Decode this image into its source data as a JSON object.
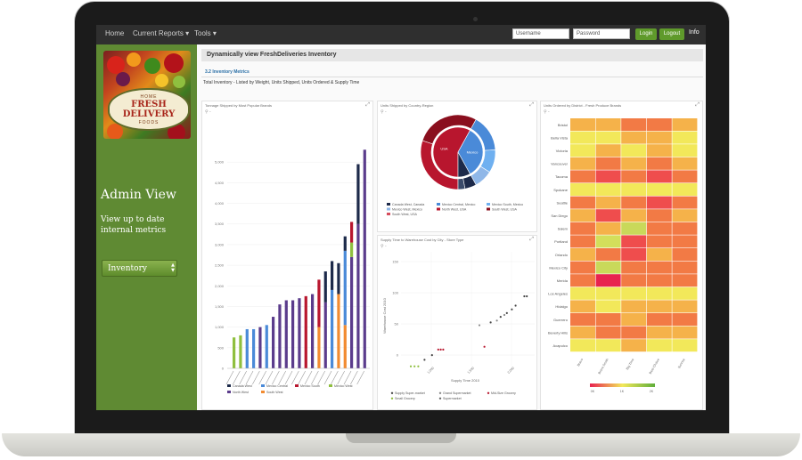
{
  "nav": {
    "home": "Home",
    "reports": "Current Reports",
    "tools": "Tools",
    "username_placeholder": "Username",
    "password_placeholder": "Password",
    "login": "Login",
    "logout": "Logout",
    "info": "Info"
  },
  "sidebar": {
    "logo_top": "HOME",
    "logo_main": "FRESH DELIVERY",
    "logo_bottom": "FOODS",
    "title": "Admin View",
    "description": "View up to date internal metrics",
    "select_value": "Inventory"
  },
  "header": {
    "title": "Dynamically view FreshDeliveries Inventory",
    "section": "3.2 Inventory Metrics",
    "subtitle": "Total Inventory - Listed by Weight, Units Shipped, Units Ordered & Supply Time"
  },
  "colors": {
    "sidebar": "#5f8a33",
    "accent_green": "#5f9a2b"
  },
  "chart_data": [
    {
      "type": "bar",
      "title": "Tonnage Shipped by Most Popular Brands",
      "ylim": [
        0,
        5500
      ],
      "yticks": [
        "0",
        "500",
        "1,000",
        "1,500",
        "2,000",
        "2,500",
        "3,000",
        "3,500",
        "4,000",
        "4,500",
        "5,000"
      ],
      "series": [
        {
          "name": "Canada West",
          "color": "#1d2a4a"
        },
        {
          "name": "Mexico Central",
          "color": "#4a8ad8"
        },
        {
          "name": "Mexico South",
          "color": "#b8162e"
        },
        {
          "name": "Mexico West",
          "color": "#8fbf3f"
        },
        {
          "name": "North West",
          "color": "#5b3c8c"
        },
        {
          "name": "South West",
          "color": "#f28b30"
        }
      ],
      "bars": [
        {
          "total": 750,
          "series": "Mexico West"
        },
        {
          "total": 800,
          "series": "Mexico West"
        },
        {
          "total": 950,
          "series": "Mexico Central"
        },
        {
          "total": 950,
          "series": "Mexico Central"
        },
        {
          "total": 1000,
          "series": "North West"
        },
        {
          "total": 1050,
          "series": "Mexico Central"
        },
        {
          "total": 1250,
          "series": "North West"
        },
        {
          "total": 1550,
          "series": "North West"
        },
        {
          "total": 1650,
          "series": "North West"
        },
        {
          "total": 1650,
          "series": "North West"
        },
        {
          "total": 1700,
          "series": "North West"
        },
        {
          "total": 1750,
          "series": "Mexico South"
        },
        {
          "total": 1800,
          "series": "North West"
        },
        {
          "total": 2150,
          "series": "Canada West",
          "split": [
            {
              "series": "South West",
              "v": 1000
            },
            {
              "series": "Mexico South",
              "v": 1150
            }
          ]
        },
        {
          "total": 2350,
          "series": "North West",
          "split": [
            {
              "series": "North West",
              "v": 1600
            },
            {
              "series": "Canada West",
              "v": 750
            }
          ]
        },
        {
          "total": 2600,
          "series": "Mexico Central",
          "split": [
            {
              "series": "Mexico Central",
              "v": 1900
            },
            {
              "series": "Canada West",
              "v": 700
            }
          ]
        },
        {
          "total": 2550,
          "series": "South West",
          "split": [
            {
              "series": "South West",
              "v": 1800
            },
            {
              "series": "Canada West",
              "v": 750
            }
          ]
        },
        {
          "total": 3200,
          "series": "Mexico Central",
          "split": [
            {
              "series": "South West",
              "v": 1050
            },
            {
              "series": "Mexico Central",
              "v": 1800
            },
            {
              "series": "Canada West",
              "v": 350
            }
          ]
        },
        {
          "total": 3550,
          "series": "North West",
          "split": [
            {
              "series": "North West",
              "v": 2700
            },
            {
              "series": "Mexico West",
              "v": 350
            },
            {
              "series": "Mexico South",
              "v": 500
            }
          ]
        },
        {
          "total": 4950,
          "series": "North West",
          "split": [
            {
              "series": "North West",
              "v": 3500
            },
            {
              "series": "Canada West",
              "v": 1450
            }
          ]
        },
        {
          "total": 5300,
          "series": "North West",
          "split": [
            {
              "series": "North West",
              "v": 5300
            }
          ]
        }
      ]
    },
    {
      "type": "pie",
      "title": "Units Shipped by Country-Region",
      "legend": [
        "Canada West, Canada",
        "Mexico Central, Mexico",
        "Mexico South, Mexico",
        "Mexico West, Mexico",
        "North West, USA",
        "South West, USA",
        "South West, USA"
      ],
      "legend_colors": [
        "#1d2a4a",
        "#4a8ad8",
        "#6fb0f0",
        "#8fb7e8",
        "#b8162e",
        "#8a0f1e",
        "#d54c5c"
      ],
      "inner": [
        {
          "label": "USA",
          "value": 0.58,
          "color": "#b8162e"
        },
        {
          "label": "Mexico",
          "value": 0.34,
          "color": "#4a8ad8"
        },
        {
          "label": "",
          "value": 0.08,
          "color": "#1d2a4a"
        }
      ],
      "outer": [
        {
          "value": 0.3,
          "color": "#b8162e"
        },
        {
          "value": 0.28,
          "color": "#8a0f1e"
        },
        {
          "value": 0.16,
          "color": "#4a8ad8"
        },
        {
          "value": 0.1,
          "color": "#6fb0f0"
        },
        {
          "value": 0.08,
          "color": "#8fb7e8"
        },
        {
          "value": 0.05,
          "color": "#1d2a4a"
        },
        {
          "value": 0.03,
          "color": "#3a4a6a"
        }
      ]
    },
    {
      "type": "scatter",
      "title": "Supply Time to Warehouse Cost by City - Store Type",
      "xlabel": "Supply Time 2010",
      "ylabel": "Warehouse Cost 2010",
      "yticks": [
        "0",
        "50",
        "100",
        "150"
      ],
      "xticks": [
        "1,000",
        "1,500",
        "2,000"
      ],
      "legend": [
        "Supply Super-market",
        "Grand Supermarket",
        "Mid-Size Grocery",
        "Small Grocery",
        "Supermarket"
      ],
      "legend_colors": [
        "#444",
        "#888",
        "#b8162e",
        "#8fbf3f",
        "#666"
      ],
      "points": [
        {
          "x": 0.05,
          "y": 0.05,
          "c": "#8fbf3f"
        },
        {
          "x": 0.08,
          "y": 0.05,
          "c": "#8fbf3f"
        },
        {
          "x": 0.11,
          "y": 0.05,
          "c": "#8fbf3f"
        },
        {
          "x": 0.16,
          "y": 0.12,
          "c": "#444"
        },
        {
          "x": 0.22,
          "y": 0.17,
          "c": "#444"
        },
        {
          "x": 0.27,
          "y": 0.23,
          "c": "#b8162e"
        },
        {
          "x": 0.29,
          "y": 0.23,
          "c": "#b8162e"
        },
        {
          "x": 0.31,
          "y": 0.23,
          "c": "#b8162e"
        },
        {
          "x": 0.64,
          "y": 0.26,
          "c": "#b8162e"
        },
        {
          "x": 0.6,
          "y": 0.49,
          "c": "#888"
        },
        {
          "x": 0.69,
          "y": 0.52,
          "c": "#444"
        },
        {
          "x": 0.74,
          "y": 0.54,
          "c": "#888"
        },
        {
          "x": 0.77,
          "y": 0.58,
          "c": "#444"
        },
        {
          "x": 0.8,
          "y": 0.6,
          "c": "#888"
        },
        {
          "x": 0.82,
          "y": 0.62,
          "c": "#444"
        },
        {
          "x": 0.86,
          "y": 0.66,
          "c": "#444"
        },
        {
          "x": 0.89,
          "y": 0.7,
          "c": "#444"
        },
        {
          "x": 0.96,
          "y": 0.8,
          "c": "#444"
        },
        {
          "x": 0.98,
          "y": 0.8,
          "c": "#444"
        }
      ]
    },
    {
      "type": "heatmap",
      "title": "Units Ordered by District - Fresh Produce Brands",
      "rows": [
        "Bristol",
        "Bella Vista",
        "Victoria",
        "Vancouver",
        "Tacoma",
        "Spokane",
        "Seattle",
        "San Diego",
        "Salem",
        "Portland",
        "Orlando",
        "Mexico City",
        "Merida",
        "Los Angeles",
        "Hidalgo",
        "Guerrero",
        "Beverly Hills",
        "Acapulco"
      ],
      "cols": [
        "Bravo",
        "Bravo Smith",
        "Big Time",
        "Best Choice",
        "Sunrise"
      ],
      "scale": [
        "0K",
        "1K",
        "2K"
      ],
      "scale_colors": [
        "#e8224f",
        "#f2e85a",
        "#5fae3a"
      ],
      "values": [
        [
          3,
          3,
          2,
          2,
          3
        ],
        [
          4,
          4,
          3,
          3,
          4
        ],
        [
          4,
          3,
          4,
          3,
          4
        ],
        [
          3,
          2,
          3,
          2,
          3
        ],
        [
          2,
          1,
          2,
          1,
          2
        ],
        [
          4,
          4,
          4,
          4,
          4
        ],
        [
          2,
          3,
          2,
          1,
          2
        ],
        [
          3,
          1,
          3,
          2,
          3
        ],
        [
          2,
          3,
          0,
          2,
          2
        ],
        [
          2,
          3,
          1,
          2,
          2
        ],
        [
          3,
          2,
          1,
          3,
          2
        ],
        [
          2,
          3,
          2,
          2,
          2
        ],
        [
          2,
          0,
          2,
          2,
          2
        ],
        [
          4,
          4,
          4,
          4,
          4
        ],
        [
          3,
          4,
          3,
          3,
          3
        ],
        [
          2,
          2,
          3,
          2,
          2
        ],
        [
          3,
          2,
          2,
          3,
          3
        ],
        [
          4,
          4,
          3,
          4,
          4
        ],
        [
          3,
          2,
          2,
          3,
          3
        ]
      ]
    }
  ]
}
